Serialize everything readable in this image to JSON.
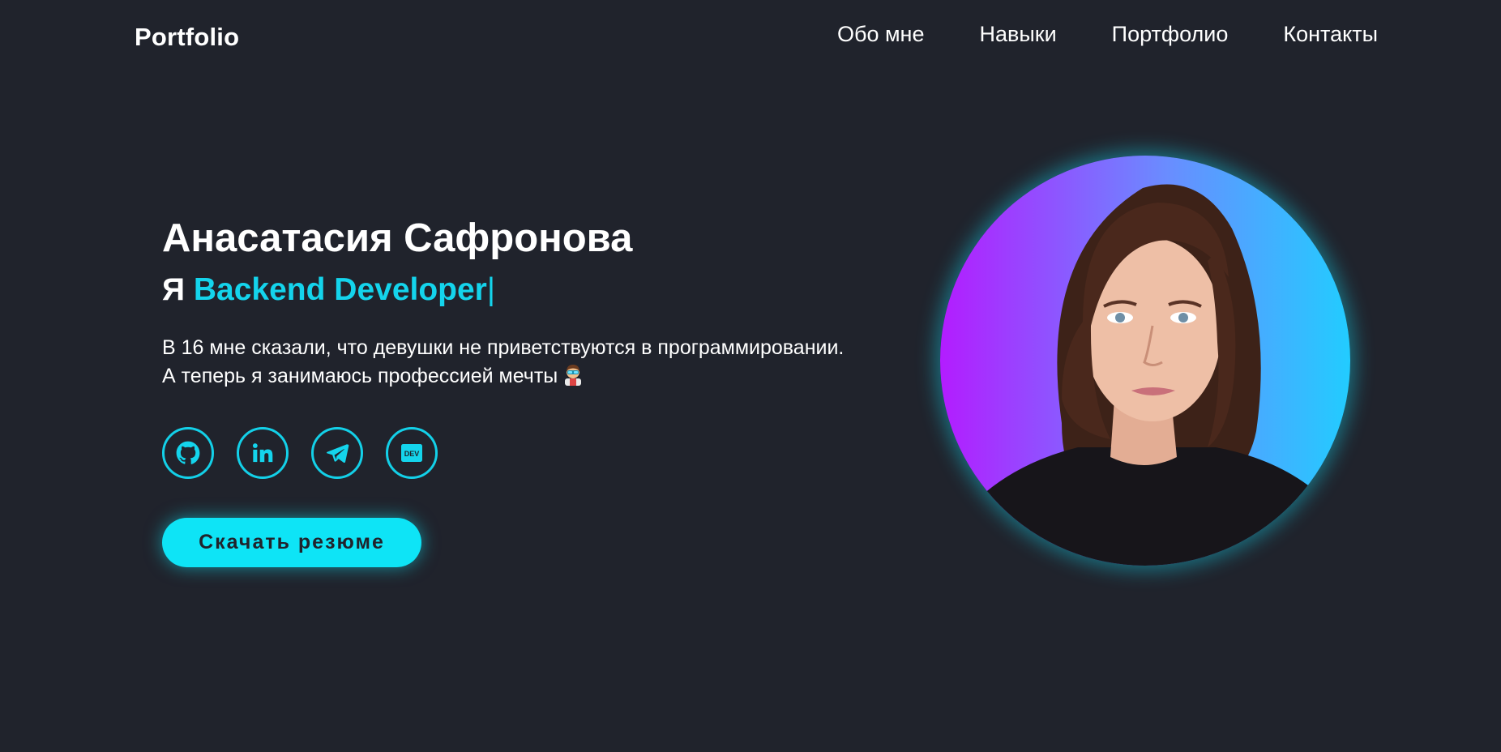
{
  "header": {
    "logo": "Portfolio",
    "nav": [
      {
        "label": "Обо мне"
      },
      {
        "label": "Навыки"
      },
      {
        "label": "Портфолио"
      },
      {
        "label": "Контакты"
      }
    ]
  },
  "hero": {
    "name": "Анасатасия Сафронова",
    "role_prefix": "Я",
    "role_title": "Backend Developer",
    "role_cursor": "|",
    "bio_line1": "В 16 мне сказали, что девушки не приветствуются в программировании.",
    "bio_line2": "А теперь я занимаюсь профессией мечты",
    "bio_emoji_icon": "woman-technologist-icon",
    "socials": [
      {
        "icon": "github-icon"
      },
      {
        "icon": "linkedin-icon"
      },
      {
        "icon": "telegram-icon"
      },
      {
        "icon": "dev-icon",
        "label": "DEV"
      }
    ],
    "cv_button": "Скачать резюме"
  },
  "colors": {
    "background": "#20232c",
    "accent": "#14d4ec",
    "button": "#0ee4f6",
    "avatar_gradient_start": "#b31cff",
    "avatar_gradient_end": "#22ccff"
  }
}
